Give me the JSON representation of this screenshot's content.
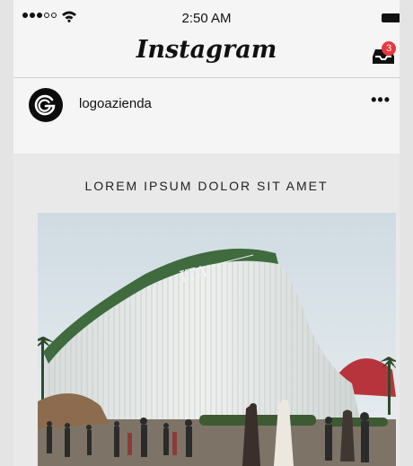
{
  "status_bar": {
    "time": "2:50 AM"
  },
  "header": {
    "app_title": "Instagram",
    "inbox_badge": "3"
  },
  "post": {
    "username": "logoazienda",
    "more_label": "•••",
    "headline": "LOREM IPSUM DOLOR SIT AMET",
    "image": {
      "building_sign": "ITA"
    }
  },
  "colors": {
    "badge": "#e6393f",
    "roof_green": "#3f6b3f",
    "background": "#f5f5f5"
  }
}
